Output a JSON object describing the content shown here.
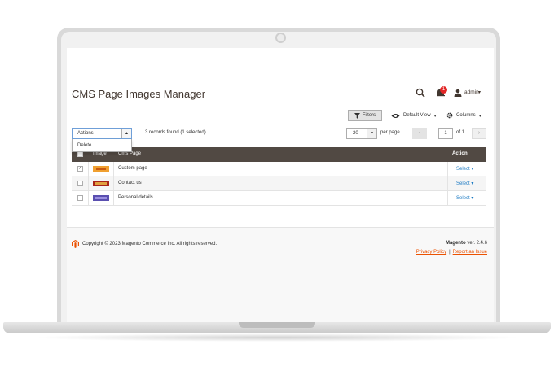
{
  "header": {
    "title": "CMS Page Images Manager",
    "notification_count": "1",
    "user": "admin"
  },
  "toolbar": {
    "filters_label": "Filters",
    "view_label": "Default View",
    "columns_label": "Columns"
  },
  "actions": {
    "label": "Actions",
    "options": [
      "Delete"
    ]
  },
  "records_text": "3 records found (1 selected)",
  "pagination": {
    "per_page_value": "20",
    "per_page_label": "per page",
    "current_page": "1",
    "of_text": "of 1"
  },
  "grid": {
    "columns": [
      "Image",
      "Cms Page",
      "Action"
    ],
    "rows": [
      {
        "checked": true,
        "page": "Custom page",
        "action": "Select"
      },
      {
        "checked": false,
        "page": "Contact us",
        "action": "Select"
      },
      {
        "checked": false,
        "page": "Personal details",
        "action": "Select"
      }
    ]
  },
  "footer": {
    "copyright": "Copyright © 2023 Magento Commerce Inc. All rights reserved.",
    "brand": "Magento",
    "version": "ver. 2.4.6",
    "privacy_label": "Privacy Policy",
    "separator": "|",
    "report_label": "Report an Issue"
  },
  "colors": {
    "grid_header": "#514943",
    "link": "#1979c3",
    "footer_link": "#eb5202",
    "badge": "#e22626"
  }
}
